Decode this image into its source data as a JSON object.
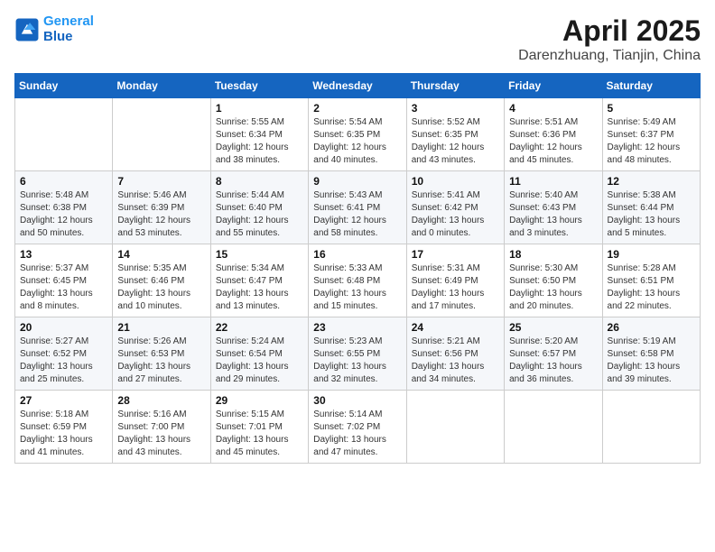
{
  "header": {
    "logo_line1": "General",
    "logo_line2": "Blue",
    "title": "April 2025",
    "subtitle": "Darenzhuang, Tianjin, China"
  },
  "weekdays": [
    "Sunday",
    "Monday",
    "Tuesday",
    "Wednesday",
    "Thursday",
    "Friday",
    "Saturday"
  ],
  "weeks": [
    [
      {
        "day": "",
        "sunrise": "",
        "sunset": "",
        "daylight": ""
      },
      {
        "day": "",
        "sunrise": "",
        "sunset": "",
        "daylight": ""
      },
      {
        "day": "1",
        "sunrise": "Sunrise: 5:55 AM",
        "sunset": "Sunset: 6:34 PM",
        "daylight": "Daylight: 12 hours and 38 minutes."
      },
      {
        "day": "2",
        "sunrise": "Sunrise: 5:54 AM",
        "sunset": "Sunset: 6:35 PM",
        "daylight": "Daylight: 12 hours and 40 minutes."
      },
      {
        "day": "3",
        "sunrise": "Sunrise: 5:52 AM",
        "sunset": "Sunset: 6:35 PM",
        "daylight": "Daylight: 12 hours and 43 minutes."
      },
      {
        "day": "4",
        "sunrise": "Sunrise: 5:51 AM",
        "sunset": "Sunset: 6:36 PM",
        "daylight": "Daylight: 12 hours and 45 minutes."
      },
      {
        "day": "5",
        "sunrise": "Sunrise: 5:49 AM",
        "sunset": "Sunset: 6:37 PM",
        "daylight": "Daylight: 12 hours and 48 minutes."
      }
    ],
    [
      {
        "day": "6",
        "sunrise": "Sunrise: 5:48 AM",
        "sunset": "Sunset: 6:38 PM",
        "daylight": "Daylight: 12 hours and 50 minutes."
      },
      {
        "day": "7",
        "sunrise": "Sunrise: 5:46 AM",
        "sunset": "Sunset: 6:39 PM",
        "daylight": "Daylight: 12 hours and 53 minutes."
      },
      {
        "day": "8",
        "sunrise": "Sunrise: 5:44 AM",
        "sunset": "Sunset: 6:40 PM",
        "daylight": "Daylight: 12 hours and 55 minutes."
      },
      {
        "day": "9",
        "sunrise": "Sunrise: 5:43 AM",
        "sunset": "Sunset: 6:41 PM",
        "daylight": "Daylight: 12 hours and 58 minutes."
      },
      {
        "day": "10",
        "sunrise": "Sunrise: 5:41 AM",
        "sunset": "Sunset: 6:42 PM",
        "daylight": "Daylight: 13 hours and 0 minutes."
      },
      {
        "day": "11",
        "sunrise": "Sunrise: 5:40 AM",
        "sunset": "Sunset: 6:43 PM",
        "daylight": "Daylight: 13 hours and 3 minutes."
      },
      {
        "day": "12",
        "sunrise": "Sunrise: 5:38 AM",
        "sunset": "Sunset: 6:44 PM",
        "daylight": "Daylight: 13 hours and 5 minutes."
      }
    ],
    [
      {
        "day": "13",
        "sunrise": "Sunrise: 5:37 AM",
        "sunset": "Sunset: 6:45 PM",
        "daylight": "Daylight: 13 hours and 8 minutes."
      },
      {
        "day": "14",
        "sunrise": "Sunrise: 5:35 AM",
        "sunset": "Sunset: 6:46 PM",
        "daylight": "Daylight: 13 hours and 10 minutes."
      },
      {
        "day": "15",
        "sunrise": "Sunrise: 5:34 AM",
        "sunset": "Sunset: 6:47 PM",
        "daylight": "Daylight: 13 hours and 13 minutes."
      },
      {
        "day": "16",
        "sunrise": "Sunrise: 5:33 AM",
        "sunset": "Sunset: 6:48 PM",
        "daylight": "Daylight: 13 hours and 15 minutes."
      },
      {
        "day": "17",
        "sunrise": "Sunrise: 5:31 AM",
        "sunset": "Sunset: 6:49 PM",
        "daylight": "Daylight: 13 hours and 17 minutes."
      },
      {
        "day": "18",
        "sunrise": "Sunrise: 5:30 AM",
        "sunset": "Sunset: 6:50 PM",
        "daylight": "Daylight: 13 hours and 20 minutes."
      },
      {
        "day": "19",
        "sunrise": "Sunrise: 5:28 AM",
        "sunset": "Sunset: 6:51 PM",
        "daylight": "Daylight: 13 hours and 22 minutes."
      }
    ],
    [
      {
        "day": "20",
        "sunrise": "Sunrise: 5:27 AM",
        "sunset": "Sunset: 6:52 PM",
        "daylight": "Daylight: 13 hours and 25 minutes."
      },
      {
        "day": "21",
        "sunrise": "Sunrise: 5:26 AM",
        "sunset": "Sunset: 6:53 PM",
        "daylight": "Daylight: 13 hours and 27 minutes."
      },
      {
        "day": "22",
        "sunrise": "Sunrise: 5:24 AM",
        "sunset": "Sunset: 6:54 PM",
        "daylight": "Daylight: 13 hours and 29 minutes."
      },
      {
        "day": "23",
        "sunrise": "Sunrise: 5:23 AM",
        "sunset": "Sunset: 6:55 PM",
        "daylight": "Daylight: 13 hours and 32 minutes."
      },
      {
        "day": "24",
        "sunrise": "Sunrise: 5:21 AM",
        "sunset": "Sunset: 6:56 PM",
        "daylight": "Daylight: 13 hours and 34 minutes."
      },
      {
        "day": "25",
        "sunrise": "Sunrise: 5:20 AM",
        "sunset": "Sunset: 6:57 PM",
        "daylight": "Daylight: 13 hours and 36 minutes."
      },
      {
        "day": "26",
        "sunrise": "Sunrise: 5:19 AM",
        "sunset": "Sunset: 6:58 PM",
        "daylight": "Daylight: 13 hours and 39 minutes."
      }
    ],
    [
      {
        "day": "27",
        "sunrise": "Sunrise: 5:18 AM",
        "sunset": "Sunset: 6:59 PM",
        "daylight": "Daylight: 13 hours and 41 minutes."
      },
      {
        "day": "28",
        "sunrise": "Sunrise: 5:16 AM",
        "sunset": "Sunset: 7:00 PM",
        "daylight": "Daylight: 13 hours and 43 minutes."
      },
      {
        "day": "29",
        "sunrise": "Sunrise: 5:15 AM",
        "sunset": "Sunset: 7:01 PM",
        "daylight": "Daylight: 13 hours and 45 minutes."
      },
      {
        "day": "30",
        "sunrise": "Sunrise: 5:14 AM",
        "sunset": "Sunset: 7:02 PM",
        "daylight": "Daylight: 13 hours and 47 minutes."
      },
      {
        "day": "",
        "sunrise": "",
        "sunset": "",
        "daylight": ""
      },
      {
        "day": "",
        "sunrise": "",
        "sunset": "",
        "daylight": ""
      },
      {
        "day": "",
        "sunrise": "",
        "sunset": "",
        "daylight": ""
      }
    ]
  ]
}
